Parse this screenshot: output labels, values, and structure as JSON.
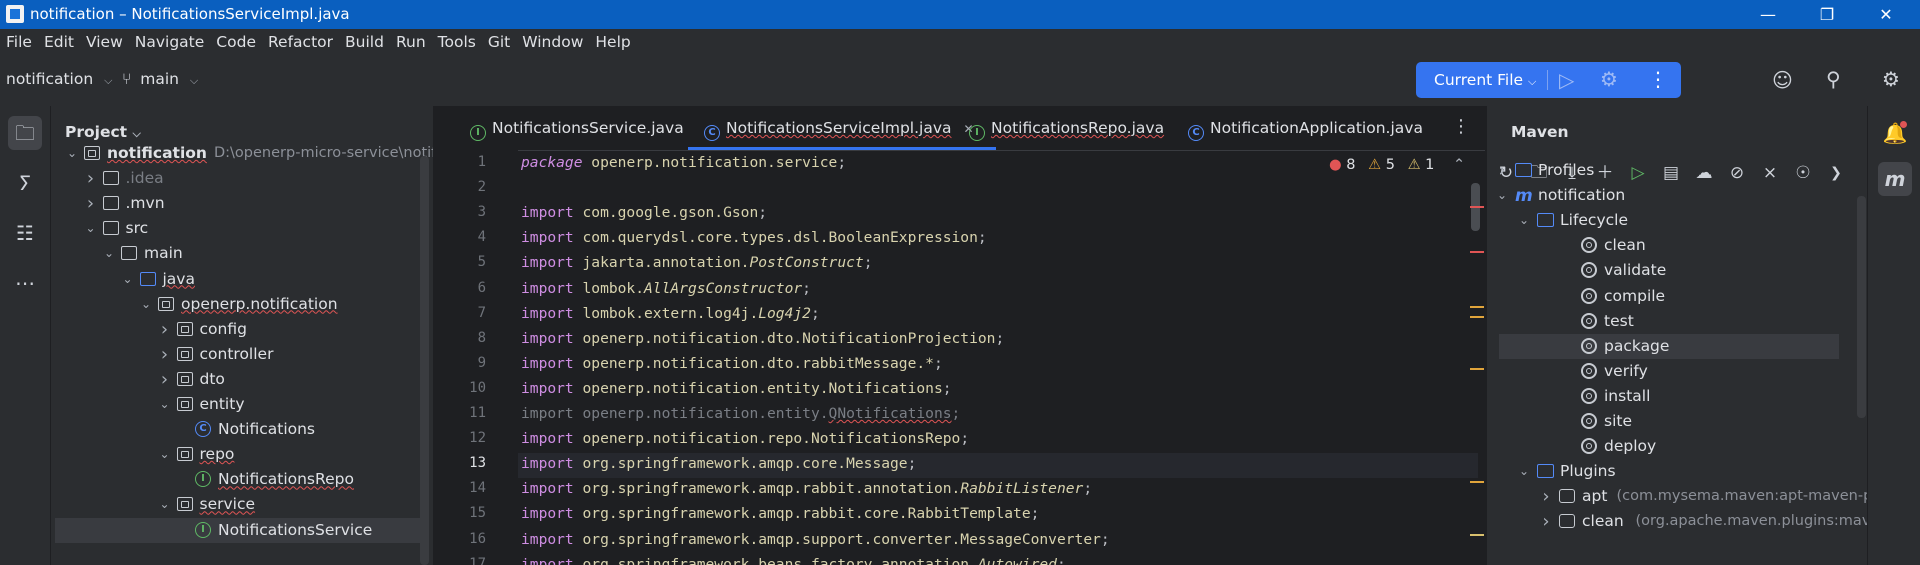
{
  "window": {
    "title": "notification – NotificationsServiceImpl.java",
    "minimize": "—",
    "maximize": "❐",
    "close": "✕"
  },
  "menu": [
    "File",
    "Edit",
    "View",
    "Navigate",
    "Code",
    "Refactor",
    "Build",
    "Run",
    "Tools",
    "Git",
    "Window",
    "Help"
  ],
  "toolbar": {
    "project": "notification",
    "branch": "main",
    "run_config": "Current File"
  },
  "project_panel": {
    "title": "Project",
    "tree": [
      {
        "label": "notification",
        "extra": "D:\\openerp-micro-service\\notification",
        "depth": 0,
        "expanded": true,
        "icon": "folder-module",
        "bold": true,
        "underline": true
      },
      {
        "label": ".idea",
        "depth": 1,
        "expanded": false,
        "icon": "folder",
        "dim": true
      },
      {
        "label": ".mvn",
        "depth": 1,
        "expanded": false,
        "icon": "folder"
      },
      {
        "label": "src",
        "depth": 1,
        "expanded": true,
        "icon": "folder"
      },
      {
        "label": "main",
        "depth": 2,
        "expanded": true,
        "icon": "folder"
      },
      {
        "label": "java",
        "depth": 3,
        "expanded": true,
        "icon": "folder-source",
        "underline": true
      },
      {
        "label": "openerp.notification",
        "depth": 4,
        "expanded": true,
        "icon": "package",
        "underline": true
      },
      {
        "label": "config",
        "depth": 5,
        "expanded": false,
        "icon": "package"
      },
      {
        "label": "controller",
        "depth": 5,
        "expanded": false,
        "icon": "package"
      },
      {
        "label": "dto",
        "depth": 5,
        "expanded": false,
        "icon": "package"
      },
      {
        "label": "entity",
        "depth": 5,
        "expanded": true,
        "icon": "package"
      },
      {
        "label": "Notifications",
        "depth": 6,
        "icon": "class"
      },
      {
        "label": "repo",
        "depth": 5,
        "expanded": true,
        "icon": "package",
        "underline": true
      },
      {
        "label": "NotificationsRepo",
        "depth": 6,
        "icon": "interface",
        "underline": true
      },
      {
        "label": "service",
        "depth": 5,
        "expanded": true,
        "icon": "package",
        "underline": true
      },
      {
        "label": "NotificationsService",
        "depth": 6,
        "icon": "interface",
        "selected": true
      }
    ]
  },
  "editor": {
    "tabs": [
      {
        "label": "NotificationsService.java",
        "icon": "interface",
        "underline": false
      },
      {
        "label": "NotificationsServiceImpl.java",
        "icon": "class",
        "active": true,
        "underline": true,
        "close": "✕"
      },
      {
        "label": "NotificationsRepo.java",
        "icon": "interface",
        "underline": true
      },
      {
        "label": "NotificationApplication.java",
        "icon": "class",
        "underline": false
      }
    ],
    "inspections": {
      "errors": "8",
      "warnings": "5",
      "weak": "1"
    },
    "current_line": 13,
    "lines": [
      {
        "n": "1",
        "t": [
          [
            "kw it",
            "package"
          ],
          [
            "pkg",
            " openerp.notification.service"
          ],
          [
            "",
            ";"
          ]
        ]
      },
      {
        "n": "2",
        "t": []
      },
      {
        "n": "3",
        "t": [
          [
            "kw",
            "import"
          ],
          [
            "pkg",
            " com.google.gson.Gson"
          ],
          [
            "",
            ";"
          ]
        ]
      },
      {
        "n": "4",
        "t": [
          [
            "kw",
            "import"
          ],
          [
            "pkg",
            " com.querydsl.core.types.dsl.BooleanExpression"
          ],
          [
            "",
            ";"
          ]
        ]
      },
      {
        "n": "5",
        "t": [
          [
            "kw",
            "import"
          ],
          [
            "pkg",
            " jakarta.annotation."
          ],
          [
            "ann",
            "PostConstruct"
          ],
          [
            "",
            ";"
          ]
        ]
      },
      {
        "n": "6",
        "t": [
          [
            "kw",
            "import"
          ],
          [
            "pkg",
            " lombok."
          ],
          [
            "ann",
            "AllArgsConstructor"
          ],
          [
            "",
            ";"
          ]
        ]
      },
      {
        "n": "7",
        "t": [
          [
            "kw",
            "import"
          ],
          [
            "pkg",
            " lombok.extern.log4j."
          ],
          [
            "ann",
            "Log4j2"
          ],
          [
            "",
            ";"
          ]
        ]
      },
      {
        "n": "8",
        "t": [
          [
            "kw",
            "import"
          ],
          [
            "pkg",
            " openerp.notification.dto.NotificationProjection"
          ],
          [
            "",
            ";"
          ]
        ]
      },
      {
        "n": "9",
        "t": [
          [
            "kw",
            "import"
          ],
          [
            "pkg",
            " openerp.notification.dto.rabbitMessage.*"
          ],
          [
            "",
            ";"
          ]
        ]
      },
      {
        "n": "10",
        "t": [
          [
            "kw",
            "import"
          ],
          [
            "pkg",
            " openerp.notification.entity.Notifications"
          ],
          [
            "",
            ";"
          ]
        ]
      },
      {
        "n": "11",
        "t": [
          [
            "grey",
            "import openerp.notification.entity."
          ],
          [
            "grey uline",
            "QNotifications"
          ],
          [
            "grey",
            ";"
          ]
        ]
      },
      {
        "n": "12",
        "t": [
          [
            "kw",
            "import"
          ],
          [
            "pkg",
            " openerp.notification.repo.NotificationsRepo"
          ],
          [
            "",
            ";"
          ]
        ]
      },
      {
        "n": "13",
        "t": [
          [
            "kw",
            "import"
          ],
          [
            "pkg",
            " org.springframework.amqp.core.Message"
          ],
          [
            "",
            ";"
          ]
        ]
      },
      {
        "n": "14",
        "t": [
          [
            "kw",
            "import"
          ],
          [
            "pkg",
            " org.springframework.amqp.rabbit.annotation."
          ],
          [
            "ann",
            "RabbitListener"
          ],
          [
            "",
            ";"
          ]
        ]
      },
      {
        "n": "15",
        "t": [
          [
            "kw",
            "import"
          ],
          [
            "pkg",
            " org.springframework.amqp.rabbit.core.RabbitTemplate"
          ],
          [
            "",
            ";"
          ]
        ]
      },
      {
        "n": "16",
        "t": [
          [
            "kw",
            "import"
          ],
          [
            "pkg",
            " org.springframework.amqp.support.converter.MessageConverter"
          ],
          [
            "",
            ";"
          ]
        ]
      },
      {
        "n": "17",
        "t": [
          [
            "kw",
            "import"
          ],
          [
            "pkg",
            " org.springframework.beans.factory.annotation."
          ],
          [
            "ann",
            "Autowired"
          ],
          [
            "",
            ";"
          ]
        ]
      }
    ]
  },
  "maven": {
    "title": "Maven",
    "tree": [
      {
        "label": "Profiles",
        "depth": 0,
        "expanded": false,
        "icon": "folder-blue"
      },
      {
        "label": "notification",
        "depth": 0,
        "expanded": true,
        "icon": "maven"
      },
      {
        "label": "Lifecycle",
        "depth": 1,
        "expanded": true,
        "icon": "folder-blue"
      },
      {
        "label": "clean",
        "depth": 2,
        "icon": "gear"
      },
      {
        "label": "validate",
        "depth": 2,
        "icon": "gear"
      },
      {
        "label": "compile",
        "depth": 2,
        "icon": "gear"
      },
      {
        "label": "test",
        "depth": 2,
        "icon": "gear"
      },
      {
        "label": "package",
        "depth": 2,
        "icon": "gear",
        "selected": true
      },
      {
        "label": "verify",
        "depth": 2,
        "icon": "gear"
      },
      {
        "label": "install",
        "depth": 2,
        "icon": "gear"
      },
      {
        "label": "site",
        "depth": 2,
        "icon": "gear"
      },
      {
        "label": "deploy",
        "depth": 2,
        "icon": "gear"
      },
      {
        "label": "Plugins",
        "depth": 1,
        "expanded": true,
        "icon": "folder-blue"
      },
      {
        "label": "apt",
        "extra": "(com.mysema.maven:apt-maven-plugin",
        "depth": 2,
        "expanded": false,
        "icon": "plugin"
      },
      {
        "label": "clean",
        "extra": "(org.apache.maven.plugins:maven-clean",
        "depth": 2,
        "expanded": false,
        "icon": "plugin"
      }
    ]
  },
  "colors": {
    "accent": "#3574f0",
    "titlebar": "#0a5fbf",
    "panel": "#2b2d30",
    "editor": "#1e1f22",
    "error": "#e05555",
    "warning": "#e0a43b"
  }
}
